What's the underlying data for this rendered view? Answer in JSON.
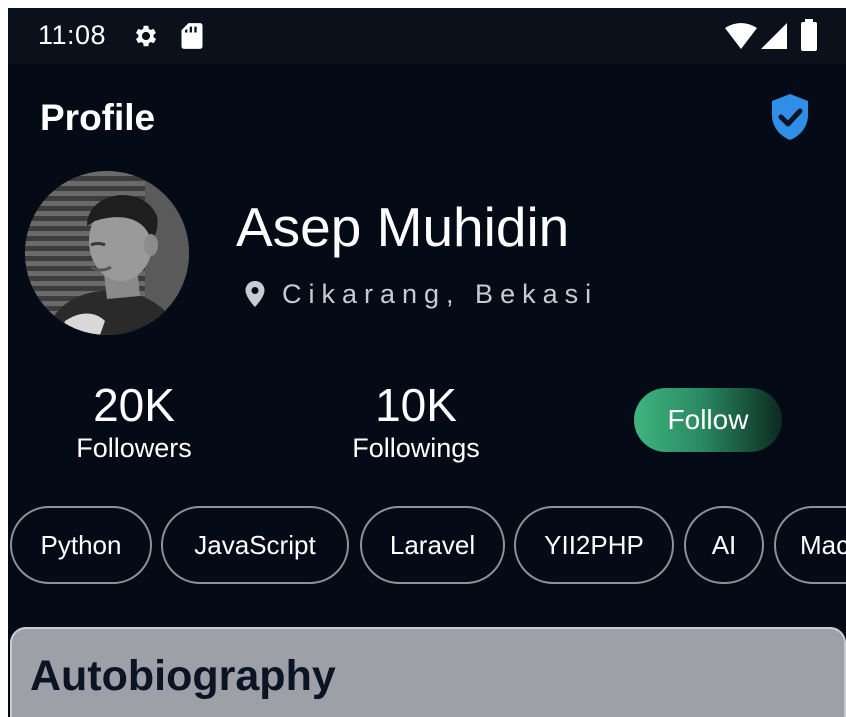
{
  "status_bar": {
    "time": "11:08",
    "icons": [
      "gear-icon",
      "sd-card-icon",
      "wifi-icon",
      "signal-icon",
      "battery-icon"
    ]
  },
  "header": {
    "title": "Profile",
    "verified_icon": "verified-shield-icon"
  },
  "profile": {
    "name": "Asep Muhidin",
    "location": "Cikarang, Bekasi",
    "location_icon": "location-pin-icon"
  },
  "stats": {
    "followers_value": "20K",
    "followers_label": "Followers",
    "followings_value": "10K",
    "followings_label": "Followings"
  },
  "actions": {
    "follow_label": "Follow"
  },
  "tags": [
    "Python",
    "JavaScript",
    "Laravel",
    "YII2PHP",
    "AI",
    "Mac"
  ],
  "card": {
    "title": "Autobiography"
  },
  "colors": {
    "background": "#050b16",
    "status_bar": "#0b111a",
    "accent_blue": "#2f8fe8",
    "follow_green": "#3fb47e",
    "tag_border": "#8d9299",
    "card_bg": "#9da0a6",
    "card_text": "#0b1424"
  }
}
